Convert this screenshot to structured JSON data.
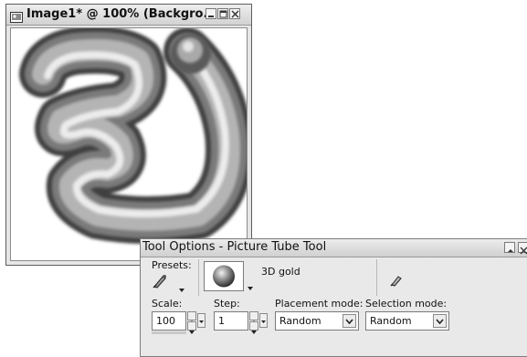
{
  "image_window": {
    "title": "Image1* @ 100% (Backgro...",
    "icons": [
      "image-document-icon",
      "minimize-icon",
      "maximize-icon",
      "close-icon"
    ]
  },
  "tool_options": {
    "title": "Tool Options - Picture Tube Tool",
    "presets_label": "Presets:",
    "tube_name": "3D gold",
    "scale_label": "Scale:",
    "scale_value": "100",
    "step_label": "Step:",
    "step_value": "1",
    "placement_label": "Placement mode:",
    "placement_value": "Random",
    "selection_label": "Selection mode:",
    "selection_value": "Random",
    "icons": [
      "picture-tube-preset-icon",
      "picture-tube-tool-icon",
      "dropdown-arrow-icon",
      "spinner-icon"
    ]
  }
}
